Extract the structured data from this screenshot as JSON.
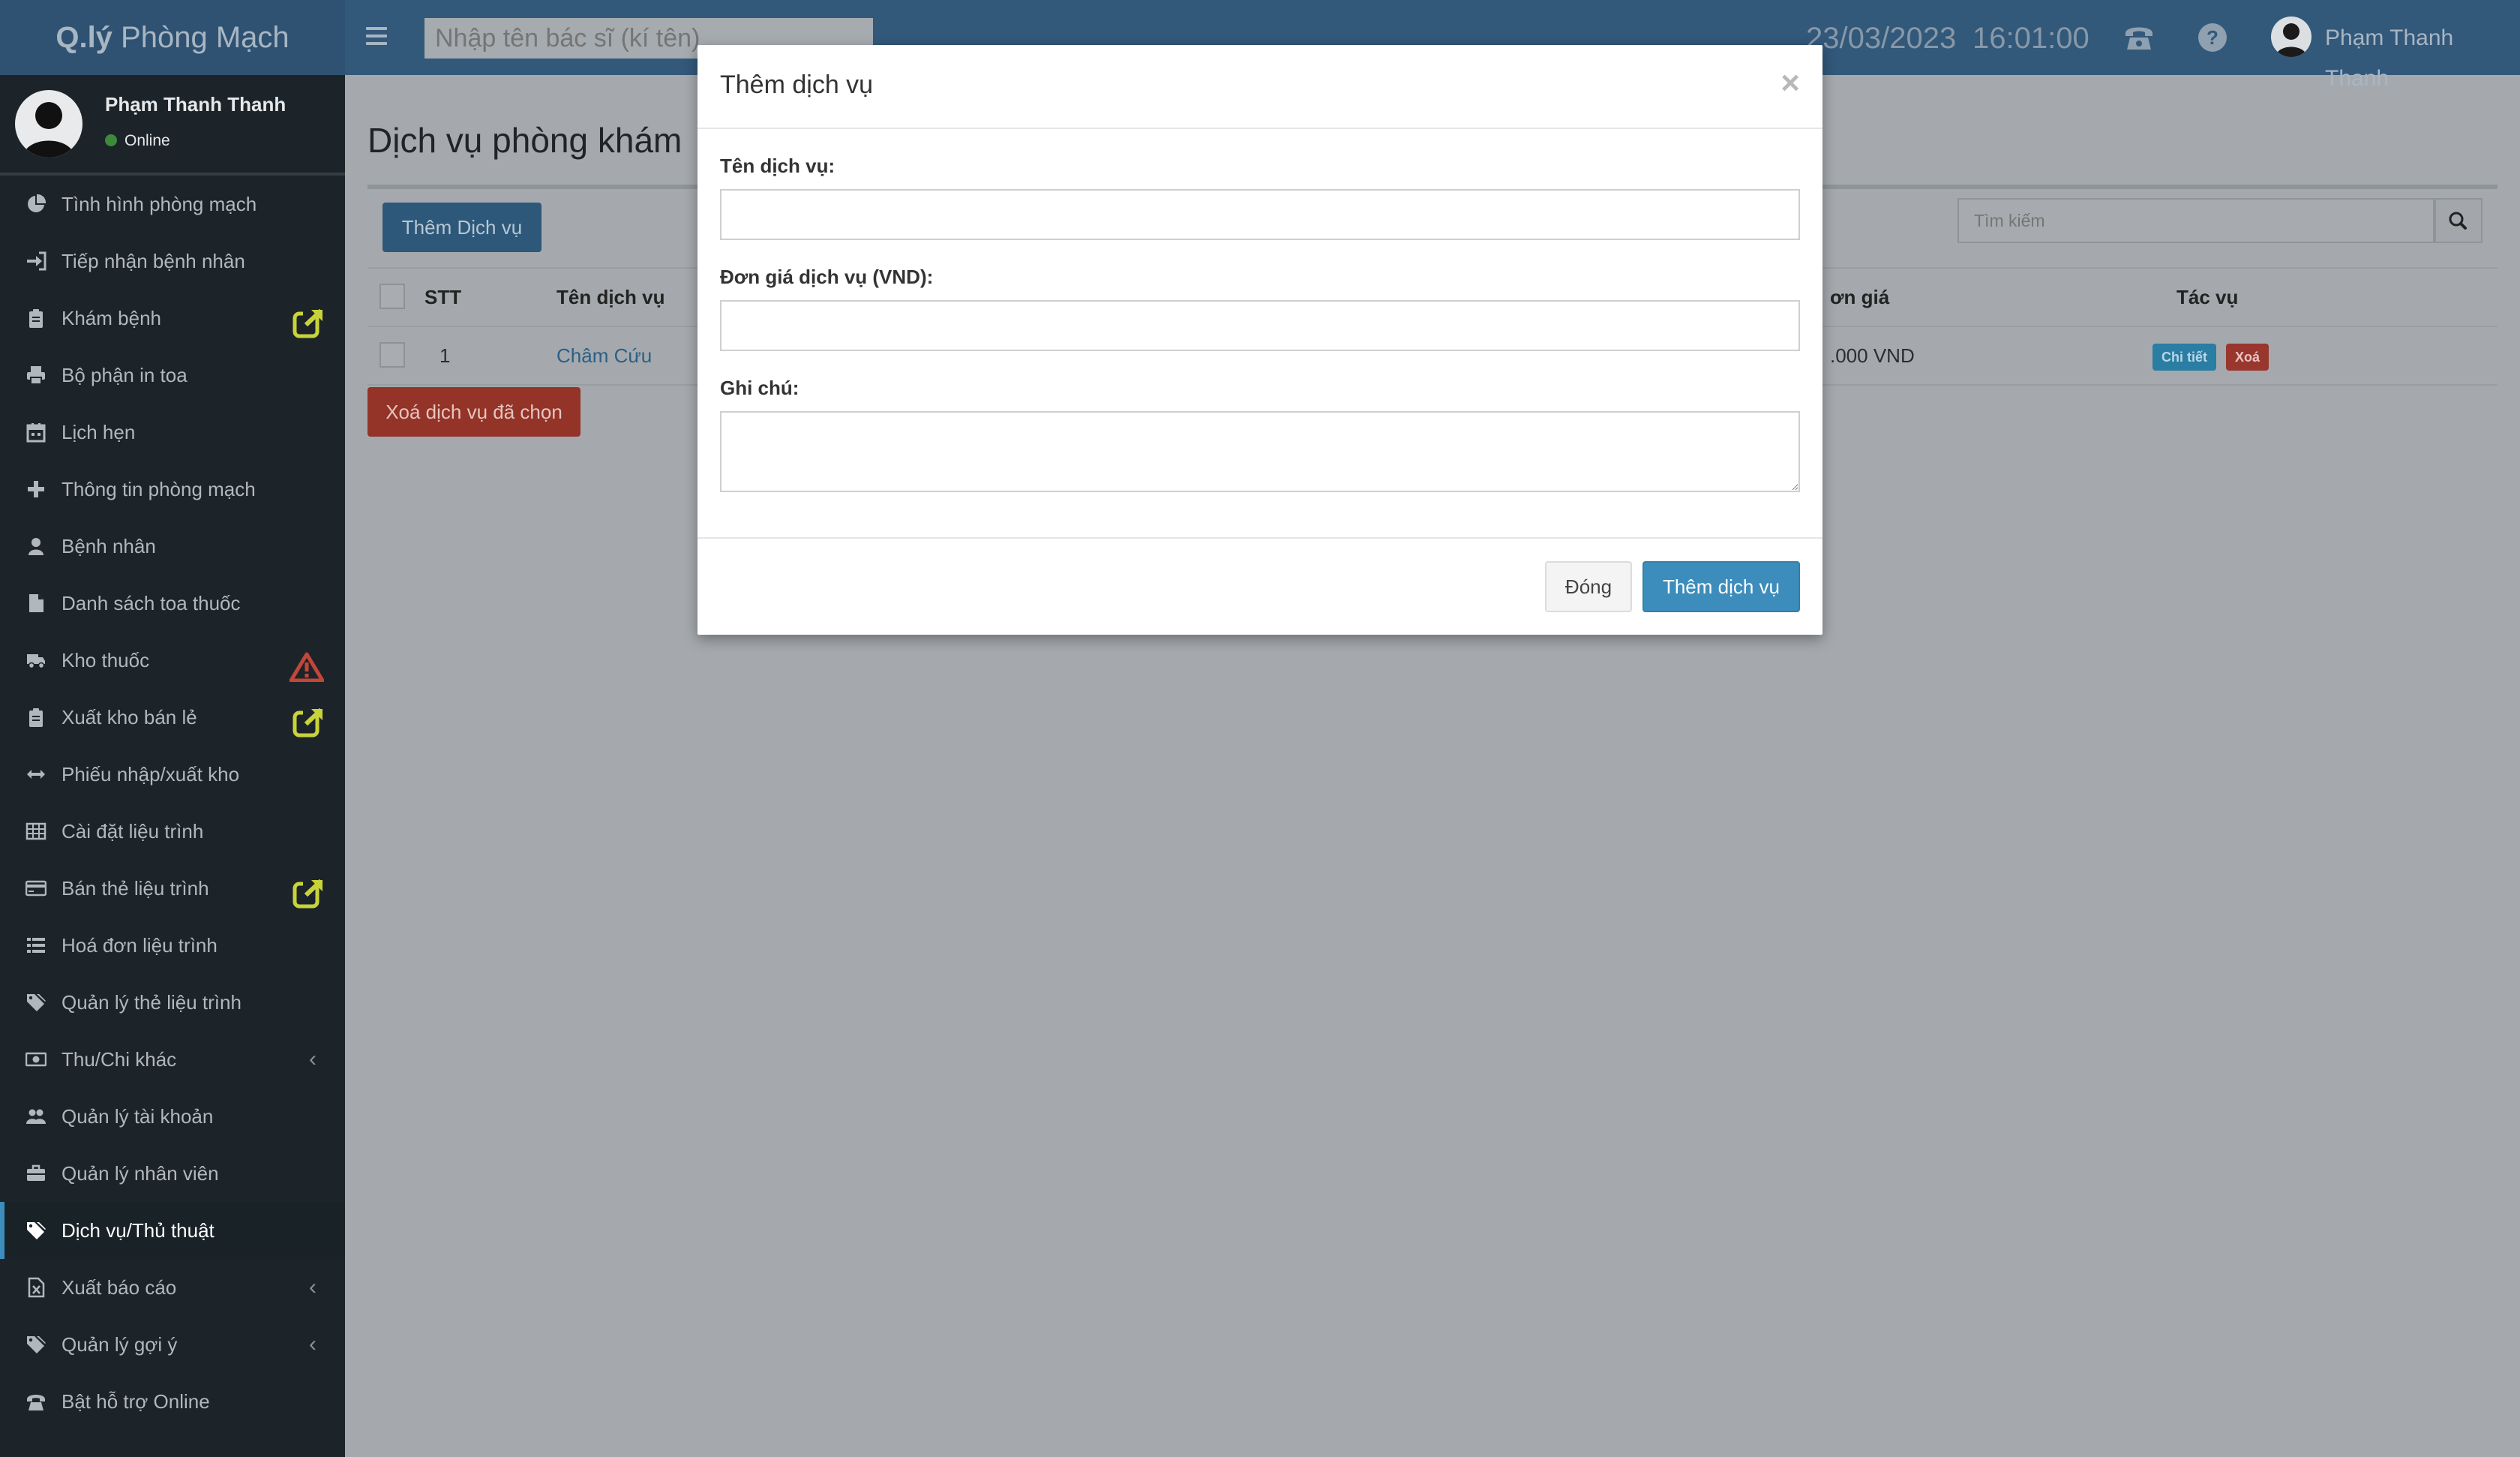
{
  "app": {
    "logo_bold": "Q.lý",
    "logo_rest": " Phòng Mạch"
  },
  "header": {
    "doctor_search_placeholder": "Nhập tên bác sĩ (kí tên)",
    "date": "23/03/2023",
    "time": "16:01:00",
    "user_name": "Phạm Thanh Thanh",
    "icons": [
      "phone-icon",
      "help-icon",
      "user-avatar"
    ]
  },
  "sidebar": {
    "user_name": "Phạm Thanh Thanh",
    "status": "Online",
    "status_color": "#3c8b3c",
    "items": [
      {
        "label": "Tình hình phòng mạch",
        "icon": "pie-chart-icon"
      },
      {
        "label": "Tiếp nhận bệnh nhân",
        "icon": "sign-in-icon"
      },
      {
        "label": "Khám bệnh",
        "icon": "clipboard-icon",
        "badge": "external-link"
      },
      {
        "label": "Bộ phận in toa",
        "icon": "print-icon"
      },
      {
        "label": "Lịch hẹn",
        "icon": "calendar-icon"
      },
      {
        "label": "Thông tin phòng mạch",
        "icon": "plus-icon"
      },
      {
        "label": "Bệnh nhân",
        "icon": "user-icon"
      },
      {
        "label": "Danh sách toa thuốc",
        "icon": "file-icon"
      },
      {
        "label": "Kho thuốc",
        "icon": "truck-icon",
        "badge": "warning"
      },
      {
        "label": "Xuất kho bán lẻ",
        "icon": "clipboard-icon",
        "badge": "external-link"
      },
      {
        "label": "Phiếu nhập/xuất kho",
        "icon": "arrows-h-icon"
      },
      {
        "label": "Cài đặt liệu trình",
        "icon": "table-icon"
      },
      {
        "label": "Bán thẻ liệu trình",
        "icon": "credit-card-icon",
        "badge": "external-link"
      },
      {
        "label": "Hoá đơn liệu trình",
        "icon": "list-icon"
      },
      {
        "label": "Quản lý thẻ liệu trình",
        "icon": "tags-icon"
      },
      {
        "label": "Thu/Chi khác",
        "icon": "money-icon",
        "chevron": "‹"
      },
      {
        "label": "Quản lý tài khoản",
        "icon": "users-icon"
      },
      {
        "label": "Quản lý nhân viên",
        "icon": "briefcase-icon"
      },
      {
        "label": "Dịch vụ/Thủ thuật",
        "icon": "tags-icon",
        "active": true
      },
      {
        "label": "Xuất báo cáo",
        "icon": "file-excel-icon",
        "chevron": "‹"
      },
      {
        "label": "Quản lý gợi ý",
        "icon": "tags-icon",
        "chevron": "‹"
      },
      {
        "label": "Bật hỗ trợ Online",
        "icon": "phone-icon"
      }
    ]
  },
  "main": {
    "title": "Dịch vụ phòng khám",
    "add_button": "Thêm Dịch vụ",
    "search_placeholder": "Tìm kiếm",
    "columns": {
      "stt": "STT",
      "name": "Tên dịch vụ",
      "price": "ơn giá",
      "actions": "Tác vụ"
    },
    "rows": [
      {
        "stt": "1",
        "name": "Châm Cứu",
        "price": ".000 VND",
        "detail": "Chi tiết",
        "delete": "Xoá"
      }
    ],
    "delete_selected": "Xoá dịch vụ đã chọn"
  },
  "modal": {
    "title": "Thêm dịch vụ",
    "close_symbol": "×",
    "name_label": "Tên dịch vụ:",
    "name_value": "",
    "price_label": "Đơn giá dịch vụ (VND):",
    "price_value": "",
    "note_label": "Ghi chú:",
    "note_value": "",
    "cancel_button": "Đóng",
    "submit_button": "Thêm dịch vụ"
  },
  "colors": {
    "header_bg": "#32587a",
    "sidebar_bg": "#1c2429",
    "primary": "#3c8dbc",
    "danger": "#943327",
    "badge_ext": "#c8d33a",
    "badge_warn": "#c0473a"
  }
}
